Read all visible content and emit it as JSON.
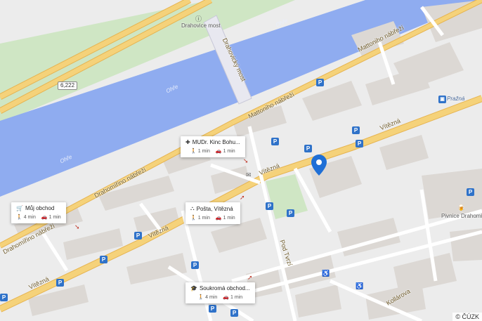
{
  "map": {
    "attribution": "© ČÚZK",
    "colors": {
      "river": "#8facf0",
      "park": "#cfe6c4",
      "road_main": "#f5d27a",
      "road_edge": "#e6b451",
      "building": "#dcd8d4",
      "background": "#ececec",
      "parking": "#2f72c9",
      "marker": "#1f6fd6"
    },
    "street_labels": [
      "Mattoniho nábřeží",
      "Mattoniho nábřeží",
      "Drahomířino nábřeží",
      "Drahomířino nábřeží",
      "Vítězná",
      "Vítězná",
      "Vítězná",
      "Vítězná",
      "Pod Tvrzí",
      "Kollárova",
      "Drahovický most"
    ],
    "river_labels": [
      "Ohře",
      "Ohře",
      "Ohře",
      "Ohře"
    ],
    "place_labels": {
      "bridge_stop": "Drahovice most",
      "prazna": "Pražná",
      "pivnice": "Pivnice Drahomíra"
    },
    "road_shield": "6,222",
    "parking_symbol": "P",
    "cards": [
      {
        "icon": "medical-cross-icon",
        "title": "MUDr. Kinc Bohu...",
        "walk": "1 min",
        "drive": "1 min"
      },
      {
        "icon": "shopping-cart-icon",
        "title": "Můj obchod",
        "walk": "4 min",
        "drive": "1 min"
      },
      {
        "icon": "post-office-icon",
        "title": "Pošta, Vítězná",
        "walk": "1 min",
        "drive": "1 min"
      },
      {
        "icon": "school-cap-icon",
        "title": "Soukromá obchod...",
        "walk": "4 min",
        "drive": "1 min"
      }
    ]
  }
}
